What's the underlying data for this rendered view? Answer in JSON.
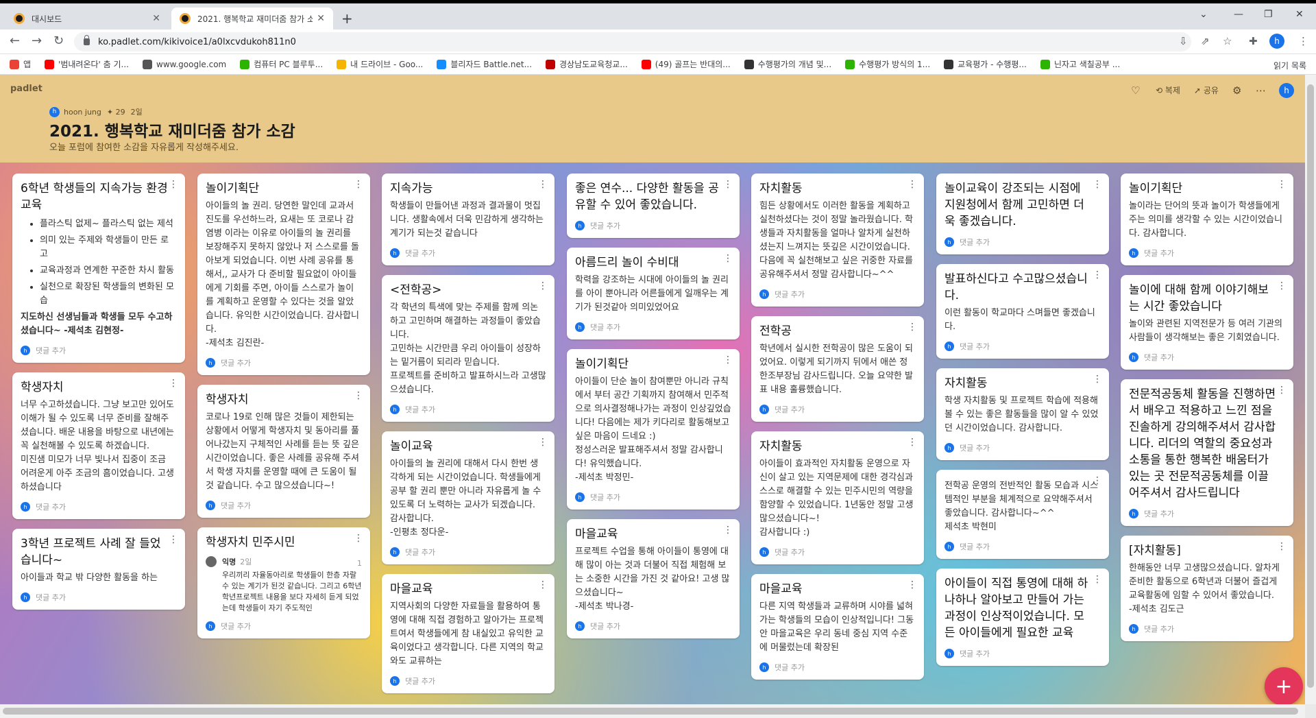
{
  "browser": {
    "tabs": [
      {
        "title": "대시보드",
        "active": false
      },
      {
        "title": "2021. 행복학교 재미더줌 참가 소감",
        "active": true
      }
    ],
    "url": "ko.padlet.com/kikivoice1/a0lxcvdukoh811n0",
    "profile_initial": "h",
    "bookmarks": [
      {
        "label": "앱",
        "color": "#ea4335"
      },
      {
        "label": "'범내려온다' 춤 기...",
        "color": "#ff0000"
      },
      {
        "label": "www.google.com",
        "color": "#555555"
      },
      {
        "label": "컴퓨터 PC 블루투...",
        "color": "#2db400"
      },
      {
        "label": "내 드라이브 - Goo...",
        "color": "#f4b400"
      },
      {
        "label": "블리자드 Battle.net...",
        "color": "#148eff"
      },
      {
        "label": "경상남도교육청교...",
        "color": "#c00000"
      },
      {
        "label": "(49) 골프는 반대의...",
        "color": "#ff0000"
      },
      {
        "label": "수행평가의 개념 및...",
        "color": "#333333"
      },
      {
        "label": "수행평가 방식의 1...",
        "color": "#2db400"
      },
      {
        "label": "교육평가 - 수행평...",
        "color": "#333333"
      },
      {
        "label": "닌자고 색칠공부 ...",
        "color": "#2db400"
      }
    ],
    "reading_list": "읽기 목록"
  },
  "padlet": {
    "brand": "padlet",
    "remake": "복제",
    "share": "공유",
    "author": "hoon jung",
    "likes": "✦ 29",
    "age": "2일",
    "title": "2021. 행복학교 재미더줌 참가 소감",
    "description": "오늘 포럼에 참여한 소감을 자유롭게 작성해주세요.",
    "add_comment": "댓글 추가"
  },
  "columns": [
    [
      {
        "title": "6학년 학생들의 지속가능 환경교육",
        "bullets": [
          "플라스틱 없제~ 플라스틱 없는 제석",
          "의미 있는 주제와 학생들이 만든 로고",
          "교육과정과 연계한 꾸준한 차시 활동",
          "실천으로 확장된 학생들의 변화된 모습"
        ],
        "body": "지도하신 선생님들과 학생들 모두 수고하셨습니다~ -제석초 김현정-"
      },
      {
        "title": "학생자치",
        "body": "너무 수고하셨습니다. 그냥 보고만 있어도 이해가 될 수 있도록 너무 준비를 잘해주셨습니다. 배운 내용을 바탕으로 내년에는 꼭 실천해볼 수 있도록 하겠습니다.\n미진샘 미모가 너무 빛나서 집중이 조금 어려운게 아주 조금의 흠이었습니다. 고생하셨습니다"
      },
      {
        "title": "3학년 프로젝트 사례 잘 들었습니다~",
        "body": "아이들과 학교 밖 다양한 활동을 하는"
      }
    ],
    [
      {
        "title": "놀이기획단",
        "body": "아이들의 놀 권리. 당연한 말인데 교과서 진도를 우선하느라, 요새는 또 코로나 감염병 이라는 이유로 아이들의 놀 권리를 보장해주지 못하지 않았나 저 스스로를 돌아보게 되었습니다. 이번 사례 공유를 통해서,, 교사가 다 준비할 필요없이 아이들에게 기회를 주면, 아이들 스스로가 놀이를 계획하고 운영할 수 있다는 것을 알았습니다. 유익한 시간이었습니다. 감사합니다.\n-제석초 김진란-"
      },
      {
        "title": "학생자치",
        "body": "코로나 19로 인해 많은 것들이 제한되는 상황에서 어떻게 학생자치 및 동아리를 풀어나갔는지 구체적인 사례를 듣는 뜻 깊은 시간이었습니다. 좋은 사례를 공유해 주셔서 학생 자치를 운영할 때에 큰 도움이 될 것 같습니다. 수고 많으셨습니다~!"
      },
      {
        "title": "학생자치 민주시민",
        "comment_count": "1",
        "commenter": "익명",
        "comment_age": "2일",
        "comment": "우리끼리 자율동아리로 학생들이 한층 자랄수 있는 계기가 된것 같습니다. 그리고 6학년 학년프로젝트 내용을 보다 자세히 듣게 되었는데 학생들이 자기 주도적인"
      }
    ],
    [
      {
        "title": "지속가능",
        "body": "학생들이 만들어낸 과정과 결과물이 멋집니다. 생활속에서 더욱 민감하게 생각하는 계기가 되는것 같습니다"
      },
      {
        "title": "<전학공>",
        "body": "각 학년의 특색에 맞는 주제를 함께 의논하고 고민하며 해결하는 과정들이 좋았습니다.\n고민하는 시간만큼 우리 아이들이 성장하는 밑거름이 되리라 믿습니다.\n프로젝트를 준비하고 발표하시느라 고생많으셨습니다."
      },
      {
        "title": "놀이교육",
        "body": "아이들의 놀 권리에 대해서 다시 한번 생각하게 되는 시간이었습니다. 학생들에게 공부 할 권리 뿐만 아니라 자유롭게 놀 수 있도록 더 노력하는 교사가 되겠습니다. 감사합니다.\n-인평초 정다운-"
      },
      {
        "title": "마을교육",
        "body": "지역사회의 다양한 자료들을 활용하여 통영에 대해 직접 경험하고 알아가는 프로젝트여서 학생들에게 참 내실있고 유익한 교육이었다고 생각합니다. 다른 지역의 학교와도 교류하는"
      }
    ],
    [
      {
        "title": "좋은 연수... 다양한 활동을 공유할 수 있어 좋았습니다.",
        "body": ""
      },
      {
        "title": "아름드리 놀이 수비대",
        "body": "학력을 강조하는 시대에 아이들의 놀 권리를 아이 뿐아니라 어른들에게 일깨우는 계기가 된것같아 의미있었어요"
      },
      {
        "title": "놀이기획단",
        "body": "아이들이 단순 놀이 참여뿐만 아니라 규칙에서 부터 공간 기획까지 참여해서 민주적으로 의사결정해나가는 과정이 인상깊었습니다! 다음에는 제가 키다리로 활동해보고싶은 마음이 드네요 :)\n정성스러운 발표해주셔서 정말 감사합니다! 유익했습니다.\n-제석초 박정민-"
      },
      {
        "title": "마을교육",
        "body": "프로젝트 수업을 통해 아이들이 통영에 대해 많이 아는 것과 더불어 직접 체험해 보는 소중한 시간을 가진 것 같아요! 고생 많으셨습니다~\n-제석초 박나경-"
      }
    ],
    [
      {
        "title": "자치활동",
        "body": "힘든 상황에서도 이러한 활동을 계획하고 실천하셨다는 것이 정말 놀라웠습니다. 학생들과 자치활동을 얼마나 알차게 실천하셨는지 느껴지는 뜻깊은 시간이었습니다. 다음에 꼭 실천해보고 싶은 귀중한 자료를 공유해주셔서 정말 감사합니다~^^"
      },
      {
        "title": "전학공",
        "body": "학년에서 실시한 전학공이 많은 도움이 되었어요. 이렇게 되기까지 뒤에서 애쓴 정한조부장님 감사드립니다. 오늘 요약한 발표 내용 훌륭했습니다."
      },
      {
        "title": "자치활동",
        "body": "아이들이 효과적인 자치활동 운영으로 자신이 살고 있는 지역문제에 대한 경각심과 스스로 해결할 수 있는 민주시민의 역량을 함양할 수 있었습니다. 1년동안 정말 고생 많으셨습니다~!\n감사합니다 :)"
      },
      {
        "title": "마을교육",
        "body": "다른 지역 학생들과 교류하며 시야를 넓혀가는 학생들의 모습이 인상적입니다! 그동안 마을교육은 우리 동네 중심 지역 수준에 머물렀는데 확장된"
      }
    ],
    [
      {
        "title": "놀이교육이 강조되는 시점에 지원청에서 함께 고민하면 더욱 좋겠습니다.",
        "body": ""
      },
      {
        "title": "발표하신다고 수고많으셨습니다.",
        "body": "이런 활동이 학교마다 스며들면 좋겠습니다."
      },
      {
        "title": "자치활동",
        "body": "학생 자치활동 및 프로젝트 학습에 적용해 볼 수 있는 좋은 활동들을 많이 알 수 있었던 시간이었습니다.  감사합니다."
      },
      {
        "title": "",
        "body": "전학공 운영의 전반적인 활동 모습과 시스템적인 부분을 체계적으로 요약해주셔서 좋았습니다. 감사합니다~^^\n제석초 박현미"
      },
      {
        "title": "아이들이 직접 통영에 대해 하나하나 알아보고 만들어 가는 과정이 인상적이었습니다. 모든 아이들에게 필요한 교육",
        "body": ""
      }
    ],
    [
      {
        "title": "놀이기획단",
        "body": "놀이라는 단어의 뜻과 놀이가 학생들에게 주는 의미를 생각할 수 있는 시간이었습니다. 감사합니다."
      },
      {
        "title": "놀이에 대해 함께 이야기해보는 시간 좋았습니다",
        "body": "놀이와 관련된 지역전문가 등 여러 기관의 사람들이 생각해보는 좋은 기회였습니다."
      },
      {
        "title": "전문적공동체 활동을 진행하면서 배우고 적용하고 느낀 점을 진솔하게 강의해주셔서 감사합니다. 리더의 역할의 중요성과 소통을 통한 행복한 배움터가 있는 곳 전문적공동체를 이끌어주셔서 감사드립니다",
        "body": ""
      },
      {
        "title": "[자치활동]",
        "body": "한해동안 너무 고생많으셨습니다. 알차게 준비한 활동으로 6학년과 더불어 즐겁게 교육활동에 임할 수 있어서 좋았습니다.\n-제석초 김도근"
      }
    ]
  ]
}
